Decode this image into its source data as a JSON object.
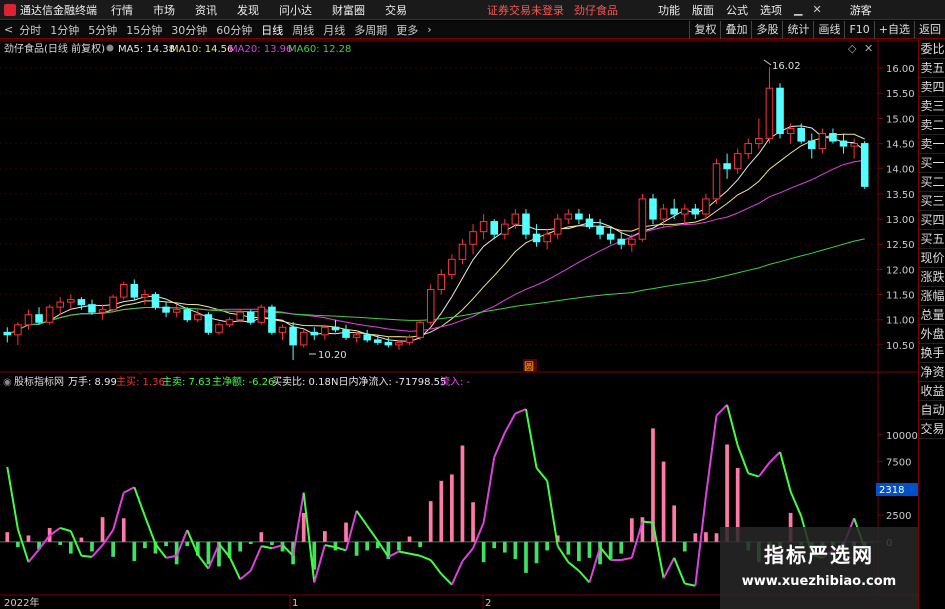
{
  "app": {
    "title": "通达信金融终端",
    "menu": [
      "行情",
      "市场",
      "资讯",
      "发现",
      "问小达",
      "财富圈",
      "交易"
    ],
    "warning": "证券交易未登录",
    "stock_name": "劲仔食品",
    "right_menu": [
      "功能",
      "版面",
      "公式",
      "选项"
    ],
    "guest": "游客"
  },
  "toolbar": {
    "back": "<",
    "periods": [
      "分时",
      "1分钟",
      "5分钟",
      "15分钟",
      "30分钟",
      "60分钟",
      "日线",
      "周线",
      "月线",
      "多周期",
      "更多"
    ],
    "active_period": "日线",
    "right_buttons": [
      "复权",
      "叠加",
      "多股",
      "统计",
      "画线",
      "F10",
      "+自选",
      "返回"
    ]
  },
  "sidebar": {
    "items": [
      "委比",
      "卖五",
      "卖四",
      "卖三",
      "卖二",
      "卖一",
      "买一",
      "买二",
      "买三",
      "买四",
      "买五",
      "现价",
      "涨跌",
      "涨幅",
      "总量",
      "外盘",
      "换手",
      "净资",
      "收益",
      "自动",
      "交易"
    ]
  },
  "main_panel": {
    "title": "劲仔食品(日线 前复权)",
    "indicators": [
      {
        "label": "MA5: 14.38",
        "color": "#e8e8e8"
      },
      {
        "label": "MA10: 14.56",
        "color": "#f0e68c"
      },
      {
        "label": "MA20: 13.96",
        "color": "#e040e0"
      },
      {
        "label": "MA60: 12.28",
        "color": "#40d040"
      }
    ],
    "high_label": "16.02",
    "low_label": "10.20",
    "marker": "圆"
  },
  "sub_panel": {
    "title": "股标指标网",
    "indicators": [
      {
        "label": "万手: 8.99",
        "color": "#e8e8e8"
      },
      {
        "label": "主买: 1.36",
        "color": "#ff3030"
      },
      {
        "label": "主卖: 7.63",
        "color": "#40ff40"
      },
      {
        "label": "主净额: -6.26",
        "color": "#40ff40"
      },
      {
        "label": "买卖比: 0.18",
        "color": "#e8e8e8"
      },
      {
        "label": "N日内净流入: -71798.55",
        "color": "#e8e8e8"
      },
      {
        "label": "流入: -",
        "color": "#ff40ff"
      }
    ],
    "current_value": "2318"
  },
  "x_axis": {
    "labels": [
      "2022年",
      "1",
      "2"
    ]
  },
  "watermark": {
    "title": "指标严选网",
    "url": "www.xuezhibiao.com"
  },
  "chart_data": [
    {
      "type": "candlestick",
      "y_axis_ticks": [
        16.0,
        15.5,
        15.0,
        14.5,
        14.0,
        13.5,
        13.0,
        12.5,
        12.0,
        11.5,
        11.0,
        10.5
      ],
      "ylim": [
        10.2,
        16.2
      ],
      "candles": [
        [
          10.75,
          10.85,
          10.55,
          10.7
        ],
        [
          10.7,
          10.95,
          10.5,
          10.9
        ],
        [
          10.9,
          11.2,
          10.8,
          11.1
        ],
        [
          11.1,
          11.25,
          10.9,
          10.95
        ],
        [
          10.95,
          11.3,
          10.9,
          11.25
        ],
        [
          11.25,
          11.45,
          11.1,
          11.35
        ],
        [
          11.35,
          11.5,
          11.2,
          11.4
        ],
        [
          11.4,
          11.45,
          11.2,
          11.3
        ],
        [
          11.3,
          11.4,
          11.1,
          11.15
        ],
        [
          11.15,
          11.3,
          11.0,
          11.2
        ],
        [
          11.2,
          11.5,
          11.15,
          11.45
        ],
        [
          11.45,
          11.75,
          11.4,
          11.7
        ],
        [
          11.7,
          11.8,
          11.4,
          11.45
        ],
        [
          11.45,
          11.6,
          11.3,
          11.5
        ],
        [
          11.5,
          11.55,
          11.2,
          11.25
        ],
        [
          11.25,
          11.35,
          11.05,
          11.15
        ],
        [
          11.15,
          11.3,
          11.05,
          11.2
        ],
        [
          11.2,
          11.25,
          10.95,
          11.0
        ],
        [
          11.0,
          11.2,
          10.95,
          11.1
        ],
        [
          11.1,
          11.15,
          10.7,
          10.75
        ],
        [
          10.75,
          10.95,
          10.7,
          10.9
        ],
        [
          10.9,
          11.05,
          10.85,
          11.0
        ],
        [
          11.0,
          11.2,
          10.95,
          11.15
        ],
        [
          11.15,
          11.2,
          10.9,
          10.95
        ],
        [
          10.95,
          11.3,
          10.9,
          11.25
        ],
        [
          11.25,
          11.3,
          10.7,
          10.75
        ],
        [
          10.75,
          10.9,
          10.6,
          10.85
        ],
        [
          10.85,
          10.95,
          10.2,
          10.5
        ],
        [
          10.5,
          10.8,
          10.45,
          10.75
        ],
        [
          10.75,
          10.85,
          10.6,
          10.7
        ],
        [
          10.7,
          10.9,
          10.6,
          10.85
        ],
        [
          10.85,
          11.0,
          10.75,
          10.8
        ],
        [
          10.8,
          10.9,
          10.6,
          10.65
        ],
        [
          10.65,
          10.75,
          10.55,
          10.7
        ],
        [
          10.7,
          10.8,
          10.55,
          10.6
        ],
        [
          10.6,
          10.7,
          10.5,
          10.55
        ],
        [
          10.55,
          10.65,
          10.45,
          10.5
        ],
        [
          10.5,
          10.6,
          10.4,
          10.55
        ],
        [
          10.55,
          10.7,
          10.5,
          10.65
        ],
        [
          10.65,
          11.0,
          10.6,
          10.95
        ],
        [
          10.95,
          11.7,
          10.9,
          11.6
        ],
        [
          11.6,
          12.0,
          11.5,
          11.9
        ],
        [
          11.9,
          12.3,
          11.8,
          12.2
        ],
        [
          12.2,
          12.6,
          12.1,
          12.5
        ],
        [
          12.5,
          12.9,
          12.3,
          12.75
        ],
        [
          12.75,
          13.1,
          12.6,
          12.95
        ],
        [
          12.95,
          13.0,
          12.6,
          12.7
        ],
        [
          12.7,
          13.0,
          12.6,
          12.9
        ],
        [
          12.9,
          13.2,
          12.8,
          13.1
        ],
        [
          13.1,
          13.2,
          12.6,
          12.7
        ],
        [
          12.7,
          12.9,
          12.45,
          12.55
        ],
        [
          12.55,
          12.8,
          12.4,
          12.7
        ],
        [
          12.7,
          13.1,
          12.6,
          13.0
        ],
        [
          13.0,
          13.2,
          12.9,
          13.1
        ],
        [
          13.1,
          13.2,
          12.9,
          13.0
        ],
        [
          13.0,
          13.1,
          12.8,
          12.85
        ],
        [
          12.85,
          13.0,
          12.6,
          12.7
        ],
        [
          12.7,
          12.85,
          12.5,
          12.6
        ],
        [
          12.6,
          12.75,
          12.4,
          12.5
        ],
        [
          12.5,
          12.7,
          12.35,
          12.6
        ],
        [
          12.6,
          13.5,
          12.55,
          13.4
        ],
        [
          13.4,
          13.5,
          12.9,
          13.0
        ],
        [
          13.0,
          13.3,
          12.85,
          13.2
        ],
        [
          13.2,
          13.4,
          13.0,
          13.1
        ],
        [
          13.1,
          13.3,
          12.9,
          13.2
        ],
        [
          13.2,
          13.3,
          13.0,
          13.1
        ],
        [
          13.1,
          13.5,
          13.0,
          13.4
        ],
        [
          13.4,
          14.2,
          13.3,
          14.1
        ],
        [
          14.1,
          14.3,
          13.8,
          14.0
        ],
        [
          14.0,
          14.4,
          13.9,
          14.3
        ],
        [
          14.3,
          14.6,
          14.2,
          14.5
        ],
        [
          14.5,
          15.0,
          14.4,
          14.6
        ],
        [
          14.6,
          16.02,
          14.5,
          15.6
        ],
        [
          15.6,
          15.7,
          14.6,
          14.7
        ],
        [
          14.7,
          14.9,
          14.5,
          14.8
        ],
        [
          14.8,
          14.9,
          14.5,
          14.55
        ],
        [
          14.55,
          14.7,
          14.2,
          14.4
        ],
        [
          14.4,
          14.8,
          14.3,
          14.7
        ],
        [
          14.7,
          14.8,
          14.5,
          14.55
        ],
        [
          14.55,
          14.7,
          14.3,
          14.45
        ],
        [
          14.45,
          14.6,
          14.2,
          14.5
        ],
        [
          14.5,
          14.55,
          13.6,
          13.65
        ]
      ]
    },
    {
      "type": "bar+line",
      "y_axis_ticks": [
        10000,
        7500,
        5000,
        2500,
        0
      ],
      "ylim": [
        -4500,
        14000
      ],
      "bars": [
        900,
        -500,
        600,
        -700,
        1300,
        -300,
        -1100,
        400,
        -900,
        2300,
        -1400,
        2200,
        -1800,
        -600,
        -1100,
        -400,
        -2100,
        -400,
        -1300,
        -2100,
        -2300,
        -1500,
        -900,
        -200,
        900,
        -300,
        -900,
        -2100,
        2700,
        -2600,
        1000,
        -800,
        1800,
        -1300,
        -800,
        -600,
        -1600,
        -800,
        500,
        -500,
        3800,
        5700,
        6300,
        9000,
        3700,
        -1900,
        -600,
        -1000,
        -1600,
        -2900,
        -2000,
        -800,
        600,
        -1200,
        -1800,
        -1500,
        -2100,
        -1600,
        -1100,
        2200,
        2300,
        10600,
        7500,
        3400,
        -900,
        800,
        900,
        800,
        9100,
        6900,
        -800,
        -1900,
        -600,
        -500,
        2700,
        -300,
        -700,
        -400,
        -300,
        -600,
        -400,
        -1000
      ],
      "line": [
        7000,
        1200,
        -1900,
        -700,
        600,
        1300,
        1000,
        -1300,
        -1400,
        -300,
        1100,
        4600,
        5100,
        2400,
        -200,
        -1500,
        -1300,
        1100,
        -1200,
        -2500,
        -200,
        -1400,
        -3500,
        -2700,
        -400,
        -600,
        -300,
        -1300,
        4600,
        -3800,
        -300,
        -500,
        -800,
        2900,
        1500,
        100,
        -1400,
        -900,
        -1100,
        -1300,
        -1700,
        -3000,
        -4000,
        -1800,
        -600,
        1800,
        7900,
        10200,
        12000,
        12400,
        6900,
        5700,
        -400,
        -1900,
        -2700,
        -3800,
        -500,
        -1700,
        -1700,
        -1500,
        1900,
        1800,
        -3400,
        -1500,
        -3900,
        -4100,
        4300,
        11800,
        12800,
        9000,
        6400,
        6100,
        7400,
        8400,
        4700,
        2400,
        -1200,
        -1500,
        -800,
        -300,
        2200,
        -600
      ]
    }
  ]
}
